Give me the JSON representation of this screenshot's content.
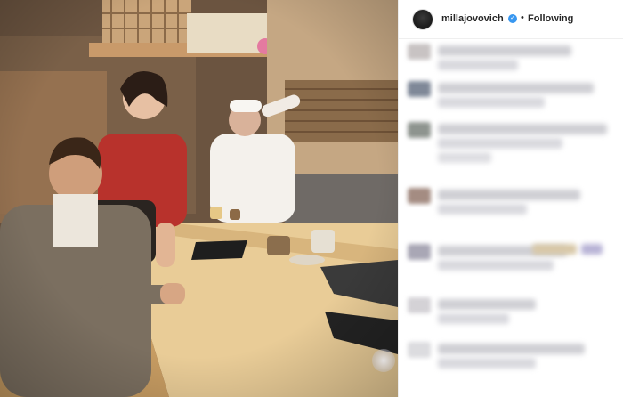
{
  "post": {
    "image_alt": "",
    "author": {
      "username": "millajovovich",
      "verified": true,
      "follow_separator": "•",
      "follow_label": "Following",
      "verified_icon": "checkmark-badge-icon"
    },
    "comments_blurred": true,
    "colors": {
      "accent_verified": "#3897f0",
      "text_primary": "#262626",
      "border": "#efefef"
    }
  }
}
